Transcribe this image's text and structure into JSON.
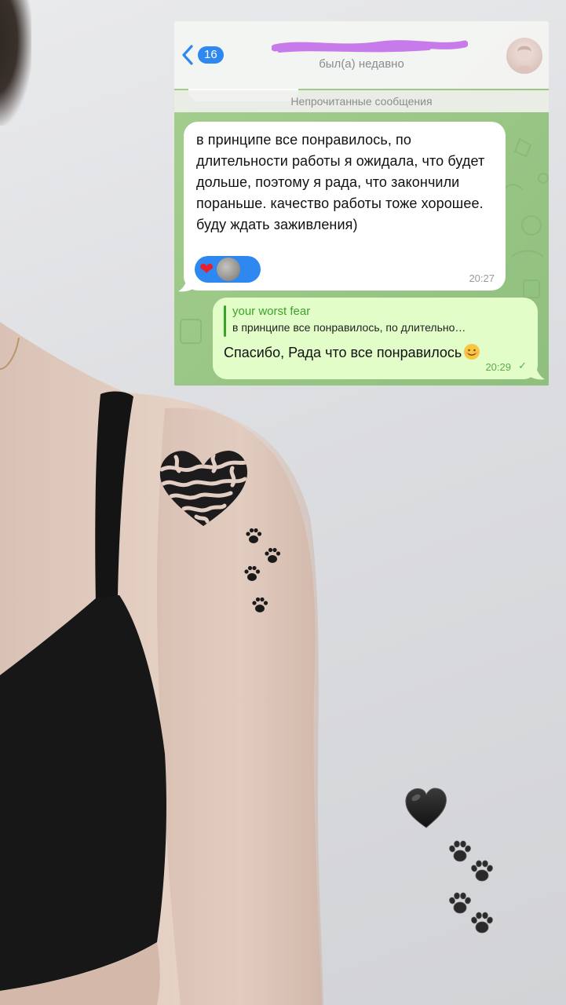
{
  "chat": {
    "back_count": "16",
    "status": "был(а) недавно",
    "unread_label": "Непрочитанные сообщения",
    "incoming": {
      "text": "в принципе все понравилось, по длительности работы я ожидала, что будет дольше, поэтому я рада, что закончили пораньше. качество работы тоже хорошее. буду ждать заживления)",
      "reaction": "❤",
      "time": "20:27"
    },
    "outgoing": {
      "reply_author": "your worst fear",
      "reply_text": "в принципе все понравилось, по длительно…",
      "text": "Спасибо, Рада что все понравилось",
      "time": "20:29",
      "status_check": "✓"
    }
  },
  "icons": {
    "back": "chevron-left-icon",
    "reaction_avatar": "avatar-icon",
    "sticker_heart": "black-heart-icon",
    "sticker_paws": "paw-prints-icon"
  },
  "colors": {
    "accent_blue": "#2f87f0",
    "chat_bg": "#9cc88a",
    "outgoing_bubble": "#e2fdc7",
    "reply_green": "#3aa32c",
    "redaction": "#c77bea"
  }
}
